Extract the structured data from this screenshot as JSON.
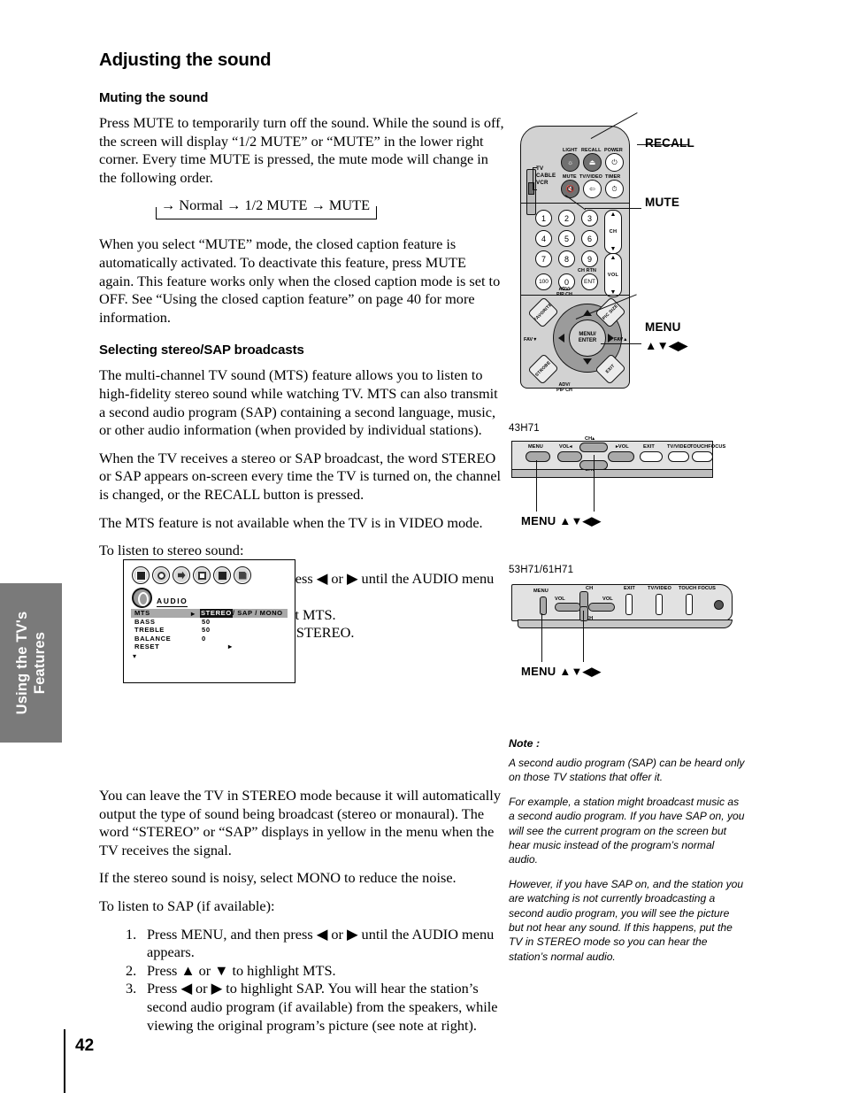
{
  "side_tab": {
    "label": "Using the TV's Features"
  },
  "page": {
    "number": "42"
  },
  "left": {
    "title": "Adjusting the sound",
    "section_mute": {
      "heading": "Muting the sound",
      "p1": "Press MUTE to temporarily turn off the sound. While the sound is off, the screen will display “1/2 MUTE” or “MUTE” in the lower right corner. Every time MUTE is pressed, the mute mode will change in the following order.",
      "flow": "→ Normal → 1/2 MUTE → MUTE",
      "p2": "When you select “MUTE” mode, the closed caption feature is automatically activated. To deactivate this feature, press MUTE again. This feature works only when the closed caption mode is set to OFF. See “Using the closed caption feature” on page 40 for more information."
    },
    "section_stereo": {
      "heading": "Selecting stereo/SAP broadcasts",
      "p1": "The multi-channel TV sound (MTS) feature allows you to listen to high-fidelity stereo sound while watching TV. MTS can also transmit a second audio program (SAP) containing a second language, music, or other audio information (when provided by individual stations).",
      "p2": "When the TV receives a stereo or SAP broadcast, the word STEREO or SAP appears on-screen every time the TV is turned on, the channel is changed, or the RECALL button is pressed.",
      "p3": "The MTS feature is not available when the TV is in VIDEO mode.",
      "lead_stereo": "To listen to stereo sound:",
      "steps_stereo": [
        "Press MENU, and then press ◀ or ▶ until the AUDIO menu appears.",
        "Press ▲ or ▼ to highlight MTS.",
        "Press ◀ or ▶ to highlight STEREO."
      ],
      "p4": "You can leave the TV in STEREO mode because it will automatically output the type of sound being broadcast (stereo or monaural). The word “STEREO” or “SAP” displays in yellow in the menu when the TV receives the signal.",
      "p5": "If the stereo sound is noisy, select MONO to reduce the noise.",
      "lead_sap": "To listen to SAP (if available):",
      "steps_sap": [
        "Press MENU, and then press ◀ or ▶ until the AUDIO menu appears.",
        "Press ▲ or ▼ to highlight MTS.",
        "Press ◀ or ▶ to highlight SAP. You will hear the station’s second audio program (if available) from the speakers, while viewing the original program’s picture (see note at right)."
      ]
    }
  },
  "osd_menu": {
    "title": "AUDIO",
    "icons": [
      "picture-icon",
      "audio-icon",
      "setup-icon",
      "lock-icon",
      "info-icon",
      "captions-icon"
    ],
    "rows": [
      {
        "name": "MTS",
        "value_selected": "STEREO",
        "value_rest": "/ SAP / MONO",
        "highlighted": true
      },
      {
        "name": "BASS",
        "value": "50",
        "highlighted": false
      },
      {
        "name": "TREBLE",
        "value": "50",
        "highlighted": false
      },
      {
        "name": "BALANCE",
        "value": "0",
        "highlighted": false
      },
      {
        "name": "RESET",
        "value": "▸",
        "highlighted": false
      }
    ],
    "more_arrow": "▾"
  },
  "remote": {
    "mode_switch": [
      "TV",
      "CABLE",
      "VCR"
    ],
    "top_labels": {
      "light": "LIGHT",
      "recall": "RECALL",
      "power": "POWER",
      "mute": "MUTE",
      "tvvideo": "TV/VIDEO",
      "timer": "TIMER"
    },
    "keypad": [
      "1",
      "2",
      "3",
      "4",
      "5",
      "6",
      "7",
      "8",
      "9",
      "100",
      "0",
      "ENT"
    ],
    "ent_sub_label": "CH RTN",
    "rockers": {
      "ch": "CH",
      "vol": "VOL"
    },
    "nav": {
      "center_line1": "MENU/",
      "center_line2": "ENTER",
      "top_label": "ADV/\nPIP CH",
      "bottom_label": "ADV/\nPIP CH",
      "left_label": "FAV▼",
      "right_label": "FAV▲",
      "corner_tl": "FAVORITE",
      "corner_tr": "PIC SIZE",
      "corner_bl": "STROBE",
      "corner_br": "EXIT"
    },
    "callouts": {
      "recall": "RECALL",
      "mute": "MUTE",
      "menu": "MENU",
      "arrows": "▲▼◀▶"
    }
  },
  "panel_43": {
    "model": "43H71",
    "buttons": [
      "MENU",
      "VOL◂",
      "CH▴",
      "▸VOL",
      "CH▾",
      "EXIT",
      "TV/VIDEO",
      "TOUCHFOCUS"
    ],
    "caption": "MENU ▲▼◀▶"
  },
  "panel_5361": {
    "model": "53H71/61H71",
    "buttons": [
      "MENU",
      "VOL",
      "CH",
      "VOL",
      "CH",
      "EXIT",
      "TV/VIDEO",
      "TOUCH FOCUS"
    ],
    "caption": "MENU ▲▼◀▶"
  },
  "note": {
    "heading": "Note :",
    "p1": "A second audio program (SAP) can be heard only on those TV stations that offer it.",
    "p2": "For example, a station might broadcast music as a second audio program. If you have SAP on, you will see the current program on the screen but hear music instead of the program’s normal audio.",
    "p3": "However, if you have SAP on, and the station you are watching is not currently broadcasting a second audio program, you will see the picture but not hear any sound. If this happens, put the TV in STEREO mode so you can hear the station’s normal audio."
  }
}
